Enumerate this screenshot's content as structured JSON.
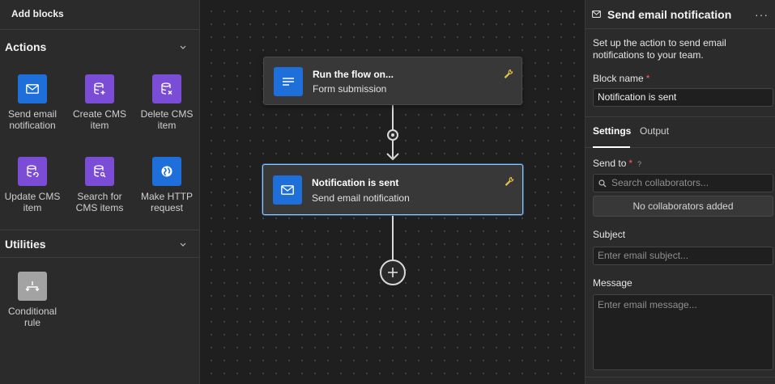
{
  "left_panel": {
    "title": "Add blocks",
    "actions": {
      "heading": "Actions",
      "items": [
        {
          "label_line1": "Send email",
          "label_line2": "notification",
          "icon": "mail-icon",
          "color": "#1e6fd9"
        },
        {
          "label_line1": "Create CMS",
          "label_line2": "item",
          "icon": "database-plus-icon",
          "color": "#7b4cd6"
        },
        {
          "label_line1": "Delete CMS",
          "label_line2": "item",
          "icon": "database-x-icon",
          "color": "#7b4cd6"
        },
        {
          "label_line1": "Update CMS",
          "label_line2": "item",
          "icon": "database-sync-icon",
          "color": "#7b4cd6"
        },
        {
          "label_line1": "Search for",
          "label_line2": "CMS items",
          "icon": "database-search-icon",
          "color": "#7b4cd6"
        },
        {
          "label_line1": "Make HTTP",
          "label_line2": "request",
          "icon": "globe-icon",
          "color": "#1e6fd9"
        }
      ]
    },
    "utilities": {
      "heading": "Utilities",
      "items": [
        {
          "label_line1": "Conditional",
          "label_line2": "rule",
          "icon": "branch-icon",
          "color": "#a3a3a3"
        }
      ]
    }
  },
  "canvas": {
    "nodes": [
      {
        "title": "Run the flow on...",
        "subtitle": "Form submission",
        "icon": "form-lines-icon",
        "selected": false
      },
      {
        "title": "Notification is sent",
        "subtitle": "Send email notification",
        "icon": "mail-icon",
        "selected": true
      }
    ],
    "add_button": "plus-circle-icon"
  },
  "right_panel": {
    "title": "Send email notification",
    "more_label": "···",
    "description": "Set up the action to send email notifications to your team.",
    "block_name_label": "Block name",
    "block_name_value": "Notification is sent",
    "tabs": [
      "Settings",
      "Output"
    ],
    "active_tab": "Settings",
    "send_to_label": "Send to",
    "search_placeholder": "Search collaborators...",
    "no_collaborators": "No collaborators added",
    "subject_label": "Subject",
    "subject_placeholder": "Enter email subject...",
    "message_label": "Message",
    "message_placeholder": "Enter email message..."
  },
  "colors": {
    "accent_blue": "#1e6fd9",
    "purple": "#7b4cd6",
    "wrench_yellow": "#e8c547",
    "required_red": "#ff5c5c"
  }
}
